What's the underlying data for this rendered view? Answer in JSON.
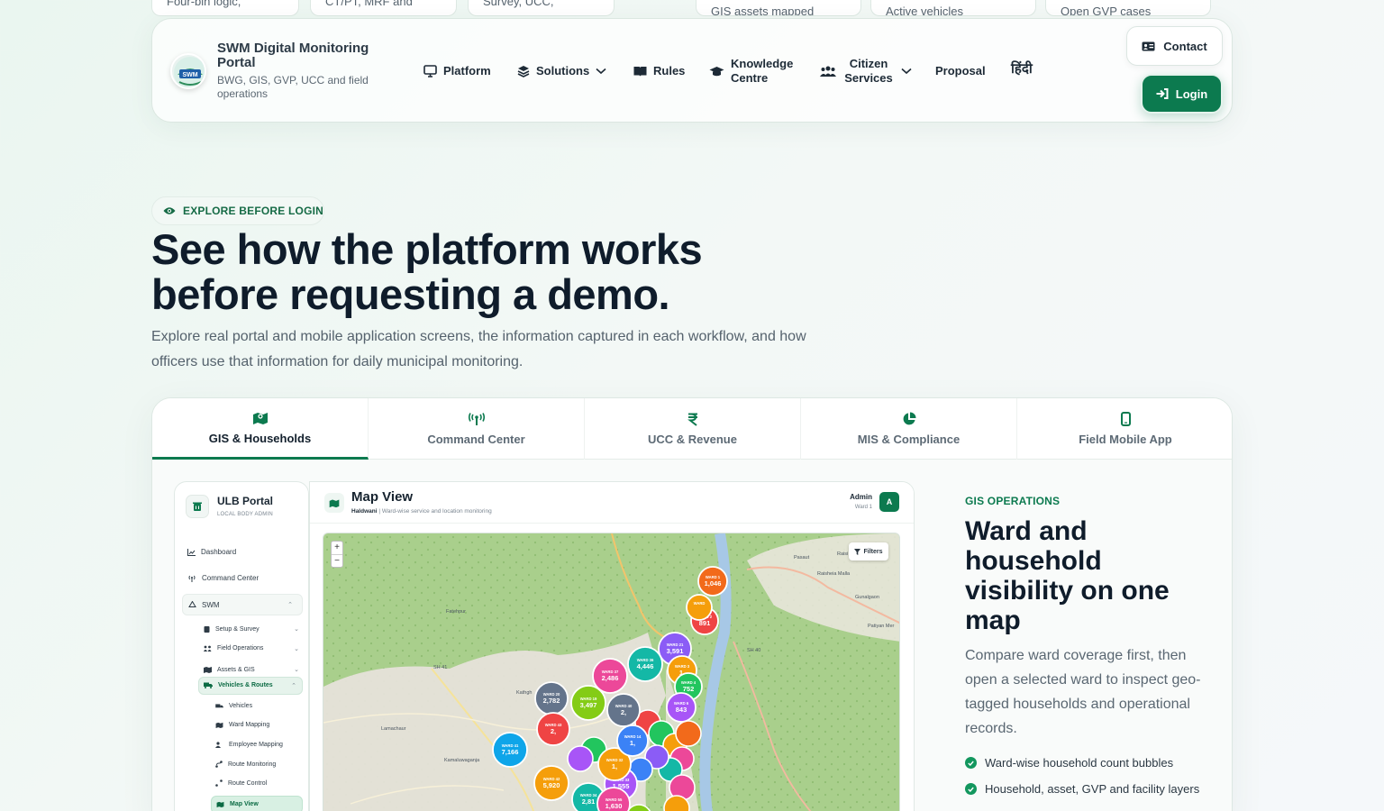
{
  "peek_cards": [
    "Four-bin logic,",
    "CT/PT, MRF and",
    "Survey, UCC,",
    "GIS assets mapped",
    "Active vehicles",
    "Open GVP cases"
  ],
  "brand": {
    "title": "SWM Digital Monitoring Portal",
    "subtitle": "BWG, GIS, GVP, UCC and field operations",
    "logo_text": "SWM"
  },
  "nav": {
    "platform": "Platform",
    "solutions": "Solutions",
    "rules": "Rules",
    "knowledge": "Knowledge Centre",
    "citizen": "Citizen Services",
    "proposal": "Proposal",
    "hindi": "हिंदी",
    "contact": "Contact",
    "login": "Login"
  },
  "hero": {
    "pill": "EXPLORE BEFORE LOGIN",
    "title": "See how the platform works before requesting a demo.",
    "description": "Explore real portal and mobile application screens, the information captured in each workflow, and how officers use that information for daily municipal monitoring."
  },
  "tabs": [
    {
      "label": "GIS & Households",
      "icon": "map-icon",
      "active": true
    },
    {
      "label": "Command Center",
      "icon": "antenna-icon",
      "active": false
    },
    {
      "label": "UCC & Revenue",
      "icon": "rupee-icon",
      "active": false
    },
    {
      "label": "MIS & Compliance",
      "icon": "pie-icon",
      "active": false
    },
    {
      "label": "Field Mobile App",
      "icon": "mobile-icon",
      "active": false
    }
  ],
  "app": {
    "side_title": "ULB Portal",
    "side_sub": "LOCAL BODY ADMIN",
    "menu": {
      "dashboard": "Dashboard",
      "command": "Command Center",
      "swm": "SWM",
      "setup": "Setup & Survey",
      "field": "Field Operations",
      "assets": "Assets & GIS",
      "vehicles_routes": "Vehicles & Routes",
      "vehicles": "Vehicles",
      "ward_mapping": "Ward Mapping",
      "employee_mapping": "Employee Mapping",
      "route_monitoring": "Route Monitoring",
      "route_control": "Route Control",
      "map_view": "Map View"
    },
    "main_title": "Map View",
    "main_city": "Haldwani",
    "main_sub": "| Ward-wise service and location monitoring",
    "admin": "Admin",
    "ward": "Ward 1",
    "avatar": "A",
    "filters": "Filters",
    "zoom_in": "+",
    "zoom_out": "−"
  },
  "map_labels": [
    "Fatehpur",
    "Kathgh",
    "Lamachaur",
    "Kamaluwaganja",
    "Raisheia Malla",
    "Gunalgaon",
    "Pasaut",
    "Raisi",
    "Patiyan Mer",
    "Kunwarpur",
    "SH 41",
    "SH 40"
  ],
  "ward_bubbles": [
    {
      "ward": "WARD 1",
      "count": "1,046",
      "color": "#f26a1b"
    },
    {
      "ward": "WARD 2",
      "count": "891",
      "color": "#ef4444"
    },
    {
      "ward": "WARD",
      "count": "",
      "color": "#f59e0b"
    },
    {
      "ward": "WARD 21",
      "count": "3,591",
      "color": "#8b5cf6"
    },
    {
      "ward": "WARD 36",
      "count": "4,446",
      "color": "#14b8a6"
    },
    {
      "ward": "WARD 37",
      "count": "2,486",
      "color": "#ec4899"
    },
    {
      "ward": "WARD 3",
      "count": "1,",
      "color": "#f59e0b"
    },
    {
      "ward": "WARD 4",
      "count": "752",
      "color": "#22c55e"
    },
    {
      "ward": "WARD 20",
      "count": "2,782",
      "color": "#64748b"
    },
    {
      "ward": "WARD 19",
      "count": "3,497",
      "color": "#84cc16"
    },
    {
      "ward": "WARD 6",
      "count": "843",
      "color": "#a855f7"
    },
    {
      "ward": "WARD 41",
      "count": "7,166",
      "color": "#0ea5e9"
    },
    {
      "ward": "WARD 42",
      "count": "5,920",
      "color": "#f59e0b"
    },
    {
      "ward": "WARD 33",
      "count": "1,555",
      "color": "#a855f7"
    },
    {
      "ward": "WARD 32",
      "count": "1,",
      "color": "#f59e0b"
    },
    {
      "ward": "WARD 43",
      "count": "2,",
      "color": "#ef4444"
    },
    {
      "ward": "WARD 14",
      "count": "1,",
      "color": "#3b82f6"
    },
    {
      "ward": "WARD 34",
      "count": "2,81",
      "color": "#14b8a6"
    },
    {
      "ward": "WARD 55",
      "count": "1,630",
      "color": "#ec4899"
    },
    {
      "ward": "WARD 40",
      "count": "2,",
      "color": "#64748b"
    }
  ],
  "info": {
    "kicker": "GIS OPERATIONS",
    "title": "Ward and household visibility on one map",
    "description": "Compare ward coverage first, then open a selected ward to inspect geo-tagged households and operational records.",
    "bullets": [
      "Ward-wise household count bubbles",
      "Household, asset, GVP and facility layers"
    ]
  },
  "colors": {
    "brand_green": "#0c7a4f",
    "accent_green": "#13975e",
    "text_dark": "#0f1c2b"
  }
}
